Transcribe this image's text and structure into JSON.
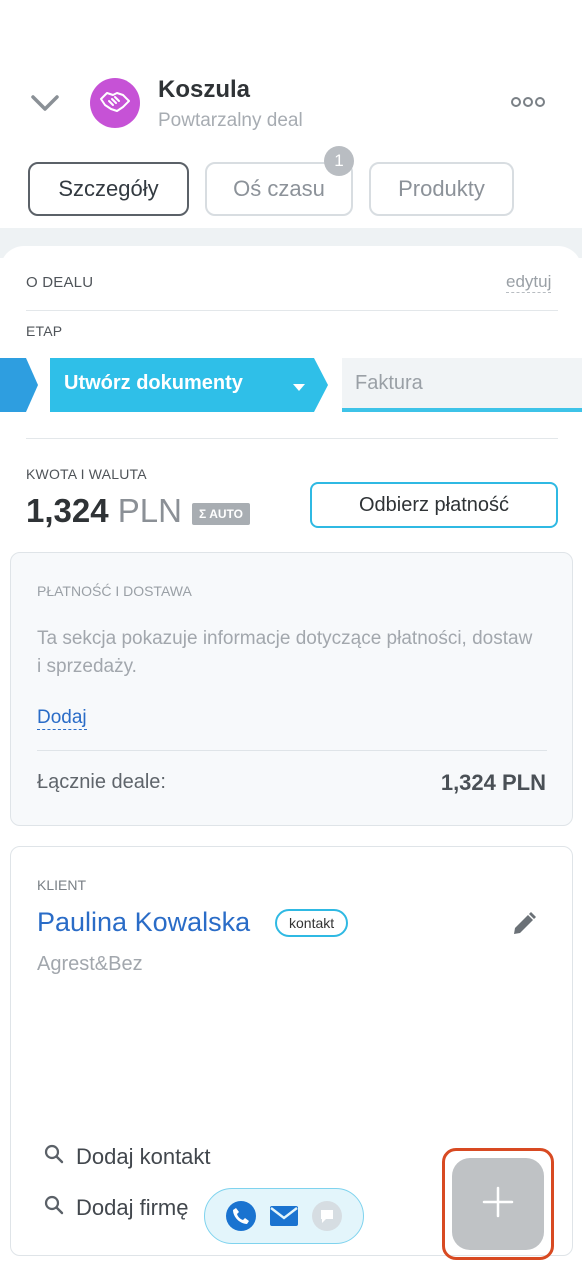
{
  "header": {
    "title": "Koszula",
    "subtitle": "Powtarzalny deal"
  },
  "tabs": [
    {
      "label": "Szczegóły",
      "active": true
    },
    {
      "label": "Oś czasu",
      "badge": "1"
    },
    {
      "label": "Produkty"
    }
  ],
  "about": {
    "section_label": "O DEALU",
    "edit_label": "edytuj"
  },
  "stage": {
    "label": "ETAP",
    "current": "Utwórz dokumenty",
    "next": "Faktura",
    "color": "#2fbfe8"
  },
  "amount": {
    "label": "KWOTA I WALUTA",
    "value": "1,324",
    "currency": "PLN",
    "auto_badge": "AUTO",
    "pay_button": "Odbierz płatność"
  },
  "payment": {
    "label": "PŁATNOŚĆ I DOSTAWA",
    "description": "Ta sekcja pokazuje informacje dotyczące płatności, dostaw i sprzedaży.",
    "add_link": "Dodaj",
    "total_label": "Łącznie deale:",
    "total_value": "1,324 PLN"
  },
  "client": {
    "label": "KLIENT",
    "name": "Paulina Kowalska",
    "tag": "kontakt",
    "company": "Agrest&Bez",
    "add_contact": "Dodaj kontakt",
    "add_company": "Dodaj firmę"
  },
  "colors": {
    "accent": "#2fb9e3",
    "link": "#2a6cc7",
    "avatar": "#c652d6",
    "highlight": "#d84a22",
    "fab": "#bfc2c5"
  },
  "icons": [
    "chevron-down-icon",
    "handshake-icon",
    "more-dots-icon",
    "dropdown-arrow-icon",
    "pencil-icon",
    "search-icon",
    "phone-icon",
    "mail-icon",
    "chat-icon",
    "plus-icon"
  ]
}
